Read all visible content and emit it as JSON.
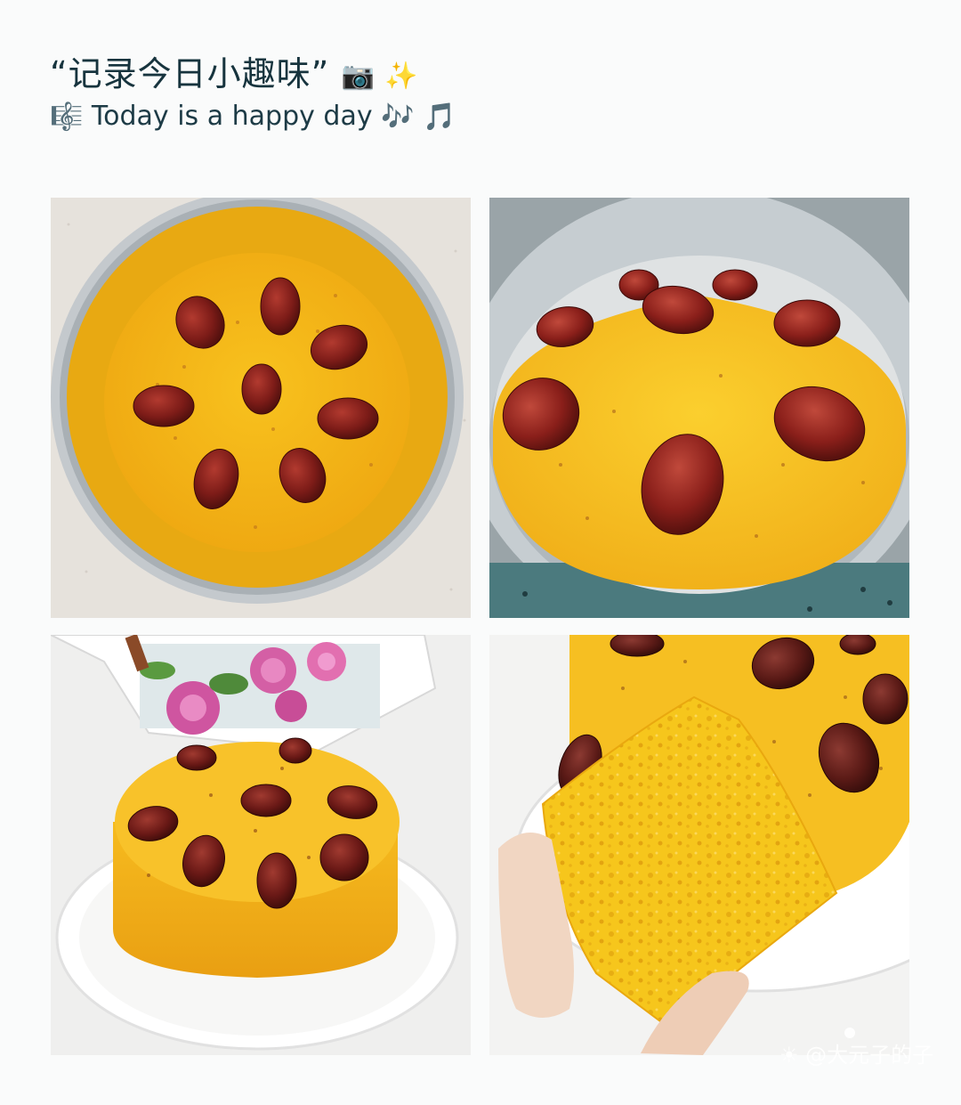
{
  "header": {
    "title": "“记录今日小趣味”",
    "title_emoji": "📷 ✨",
    "subtitle_icon": "🎼",
    "subtitle": "Today is a happy day",
    "subtitle_emoji": "🎶 🎵"
  },
  "photos": [
    {
      "name": "batter-in-pan-photo"
    },
    {
      "name": "steamed-cake-in-pan-photo"
    },
    {
      "name": "cake-on-plate-photo"
    },
    {
      "name": "cake-slice-closeup-photo"
    }
  ],
  "watermark": {
    "icon": "☀",
    "text": "@大元子的子"
  },
  "colors": {
    "background": "#fafbfb",
    "cake_yellow": "#f3b21a",
    "date_red": "#7a1a1a",
    "pan_silver": "#b9bfc4"
  }
}
